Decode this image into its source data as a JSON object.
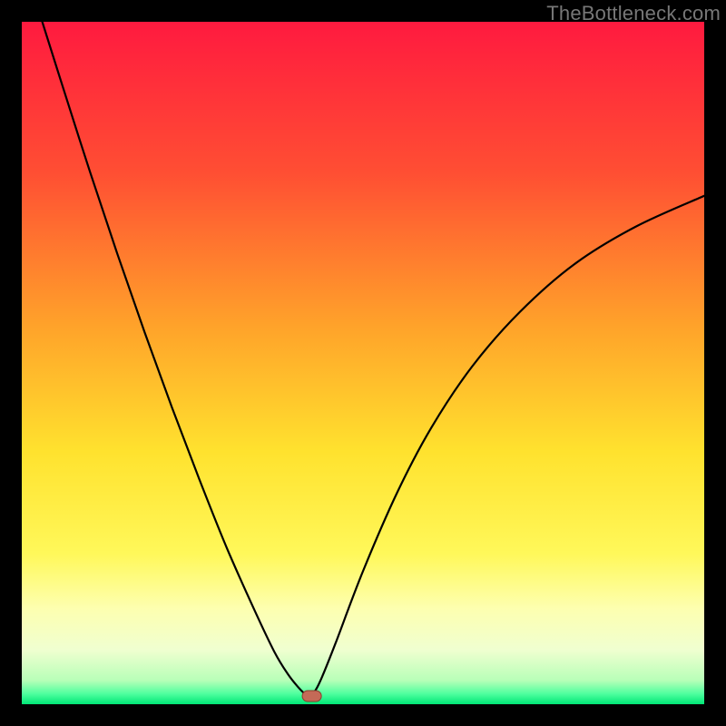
{
  "watermark": "TheBottleneck.com",
  "chart_data": {
    "type": "line",
    "title": "",
    "xlabel": "",
    "ylabel": "",
    "xlim": [
      0,
      100
    ],
    "ylim": [
      0,
      100
    ],
    "background_gradient": {
      "stops": [
        {
          "offset": 0.0,
          "color": "#ff1a3f"
        },
        {
          "offset": 0.22,
          "color": "#ff4e33"
        },
        {
          "offset": 0.45,
          "color": "#ffa42a"
        },
        {
          "offset": 0.63,
          "color": "#ffe22e"
        },
        {
          "offset": 0.78,
          "color": "#fff85a"
        },
        {
          "offset": 0.86,
          "color": "#fdffb0"
        },
        {
          "offset": 0.92,
          "color": "#f0ffd0"
        },
        {
          "offset": 0.965,
          "color": "#b8ffb8"
        },
        {
          "offset": 0.985,
          "color": "#4dff9e"
        },
        {
          "offset": 1.0,
          "color": "#00e676"
        }
      ]
    },
    "curve": {
      "stroke": "#000000",
      "stroke_width": 2.2,
      "x": [
        3,
        6,
        10,
        14,
        18,
        22,
        26,
        30,
        34,
        37,
        39,
        40.5,
        41.5,
        42,
        43,
        44,
        46,
        50,
        55,
        60,
        66,
        73,
        81,
        90,
        100
      ],
      "y": [
        100,
        90.5,
        78,
        66,
        54.5,
        43.5,
        33,
        23,
        14,
        7.7,
        4.4,
        2.5,
        1.5,
        1.2,
        2,
        4,
        9,
        19.5,
        31,
        40.5,
        49.5,
        57.5,
        64.5,
        70,
        74.5
      ]
    },
    "marker": {
      "shape": "rounded-rect",
      "cx": 42.5,
      "cy": 1.2,
      "w": 2.8,
      "h": 1.6,
      "rx": 0.8,
      "fill": "#c46a57",
      "stroke": "#8a3d2e"
    }
  }
}
